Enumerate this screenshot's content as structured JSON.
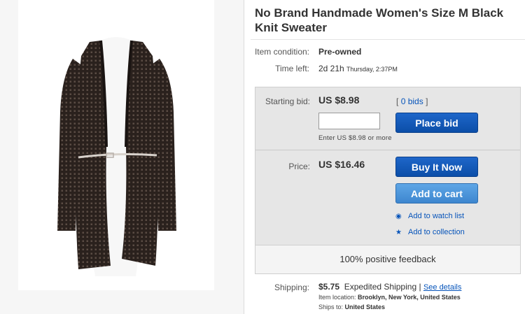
{
  "listing": {
    "title": "No Brand Handmade Women's Size M Black Knit Sweater",
    "condition_label": "Item condition:",
    "condition_value": "Pre-owned",
    "time_label": "Time left:",
    "time_value": "2d 21h",
    "time_detail": "Thursday, 2:37PM"
  },
  "bid": {
    "label": "Starting bid:",
    "amount": "US $8.98",
    "bids_open": "[",
    "bids_count": "0 bids",
    "bids_close": "]",
    "input_value": "",
    "hint": "Enter US $8.98 or more",
    "place_bid_label": "Place bid"
  },
  "buy": {
    "label": "Price:",
    "amount": "US $16.46",
    "buy_now_label": "Buy It Now",
    "add_cart_label": "Add to cart",
    "watch_label": "Add to watch list",
    "collection_label": "Add to collection"
  },
  "seller": {
    "feedback": "100% positive feedback"
  },
  "shipping": {
    "label": "Shipping:",
    "cost": "$5.75",
    "method": "Expedited Shipping",
    "separator": "|",
    "details_link": "See details",
    "location_label": "Item location:",
    "location_value": "Brooklyn, New York, United States",
    "ships_label": "Ships to:",
    "ships_value": "United States"
  },
  "colors": {
    "primary_button": "#0b4ea8",
    "secondary_button": "#3d86cf",
    "link": "#0654ba"
  },
  "icons": {
    "watch": "eye-icon",
    "collection": "star-icon"
  }
}
